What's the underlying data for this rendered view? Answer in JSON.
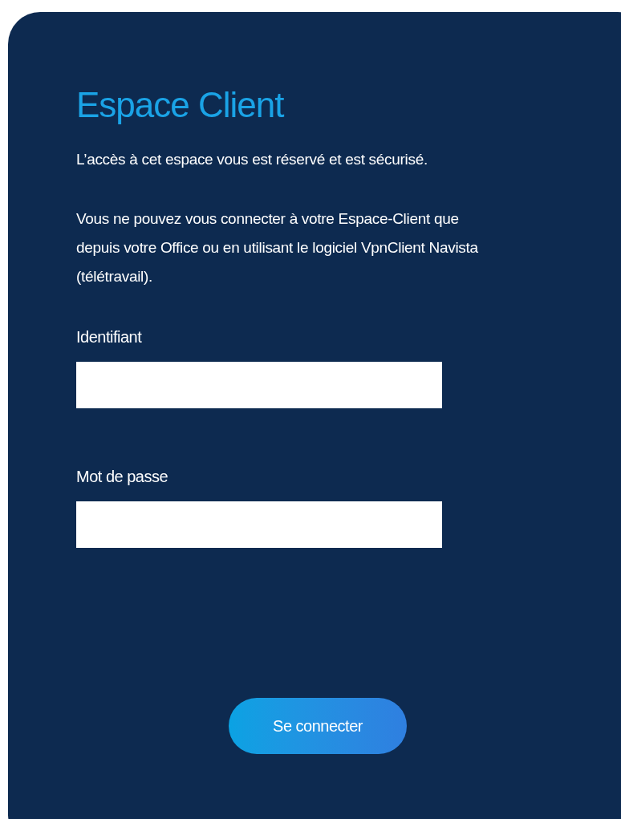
{
  "title": "Espace Client",
  "paragraphs": [
    "L’accès à cet espace vous est réservé et est sécurisé.",
    "Vous ne pouvez vous connecter à votre Espace-Client que depuis votre Office ou en utilisant le logiciel VpnClient Navista (télétravail)."
  ],
  "fields": [
    {
      "label": "Identifiant"
    },
    {
      "label": "Mot de passe"
    }
  ],
  "submit": {
    "label": "Se connecter"
  }
}
